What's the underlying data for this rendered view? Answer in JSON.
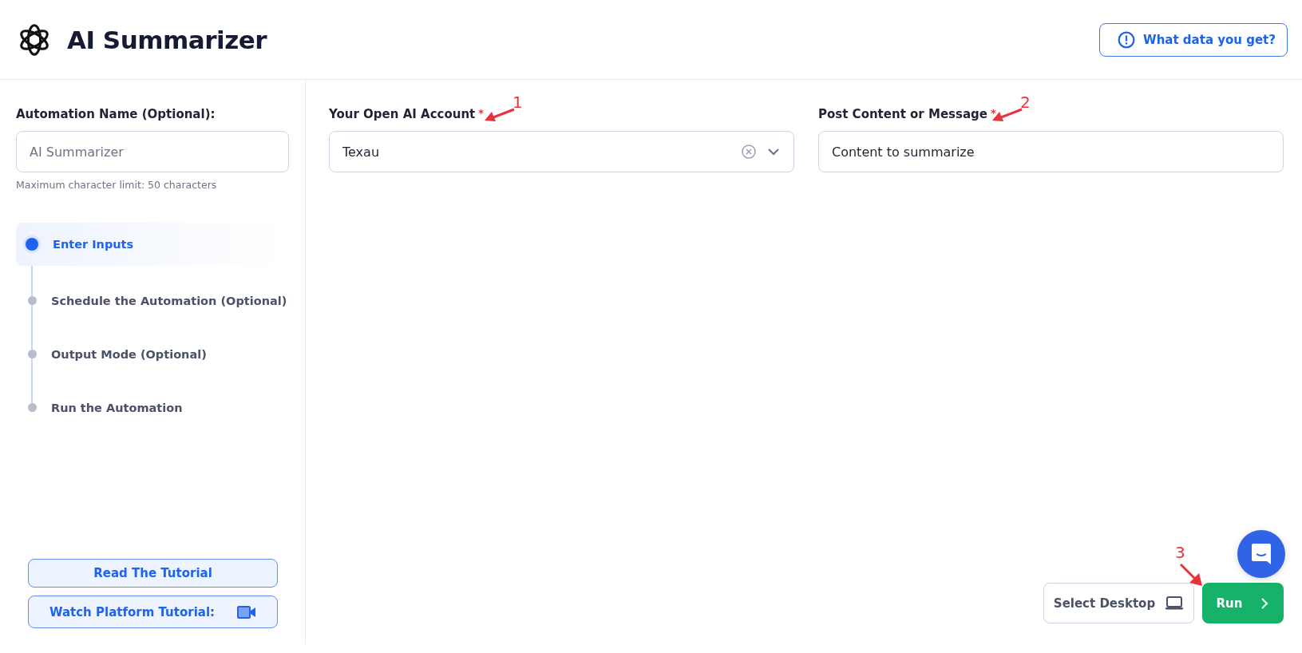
{
  "header": {
    "title": "AI Summarizer",
    "help_button": "What data you get?"
  },
  "sidebar": {
    "name_label": "Automation Name (Optional):",
    "name_placeholder": "AI Summarizer",
    "hint": "Maximum character limit: 50 characters",
    "steps": [
      {
        "label": "Enter Inputs",
        "selected": true
      },
      {
        "label": "Schedule the Automation (Optional)",
        "selected": false
      },
      {
        "label": "Output Mode (Optional)",
        "selected": false
      },
      {
        "label": "Run the Automation",
        "selected": false
      }
    ],
    "buttons": [
      "Read The Tutorial",
      "Watch Platform Tutorial:"
    ]
  },
  "form": {
    "fields": [
      {
        "kind": "select",
        "label": "Your Open AI Account",
        "required_mark": "*",
        "value": "Texau",
        "annotation": "1"
      },
      {
        "kind": "text",
        "label": "Post Content or Message",
        "required_mark": "*",
        "value": "Content to summarize",
        "annotation": "2"
      }
    ]
  },
  "footer": {
    "desktop_button": "Select Desktop",
    "run_button": "Run",
    "annotation": "3"
  }
}
